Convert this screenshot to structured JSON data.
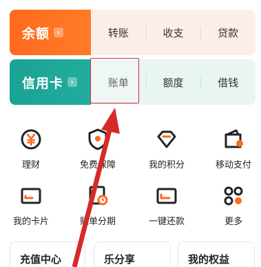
{
  "balance_row": {
    "title": "余额",
    "items": [
      "转账",
      "收支",
      "贷款"
    ]
  },
  "credit_row": {
    "title": "信用卡",
    "items": [
      "账单",
      "额度",
      "借钱"
    ]
  },
  "grid": {
    "row1": [
      "理财",
      "免费保障",
      "我的积分",
      "移动支付"
    ],
    "row2": [
      "我的卡片",
      "账单分期",
      "一键还款",
      "更多"
    ]
  },
  "bottom_cards": [
    "充值中心",
    "乐分享",
    "我的权益"
  ],
  "colors": {
    "accent_orange": "#ff6a1f",
    "accent_teal": "#1aa395",
    "highlight_red": "#d62a2a"
  }
}
